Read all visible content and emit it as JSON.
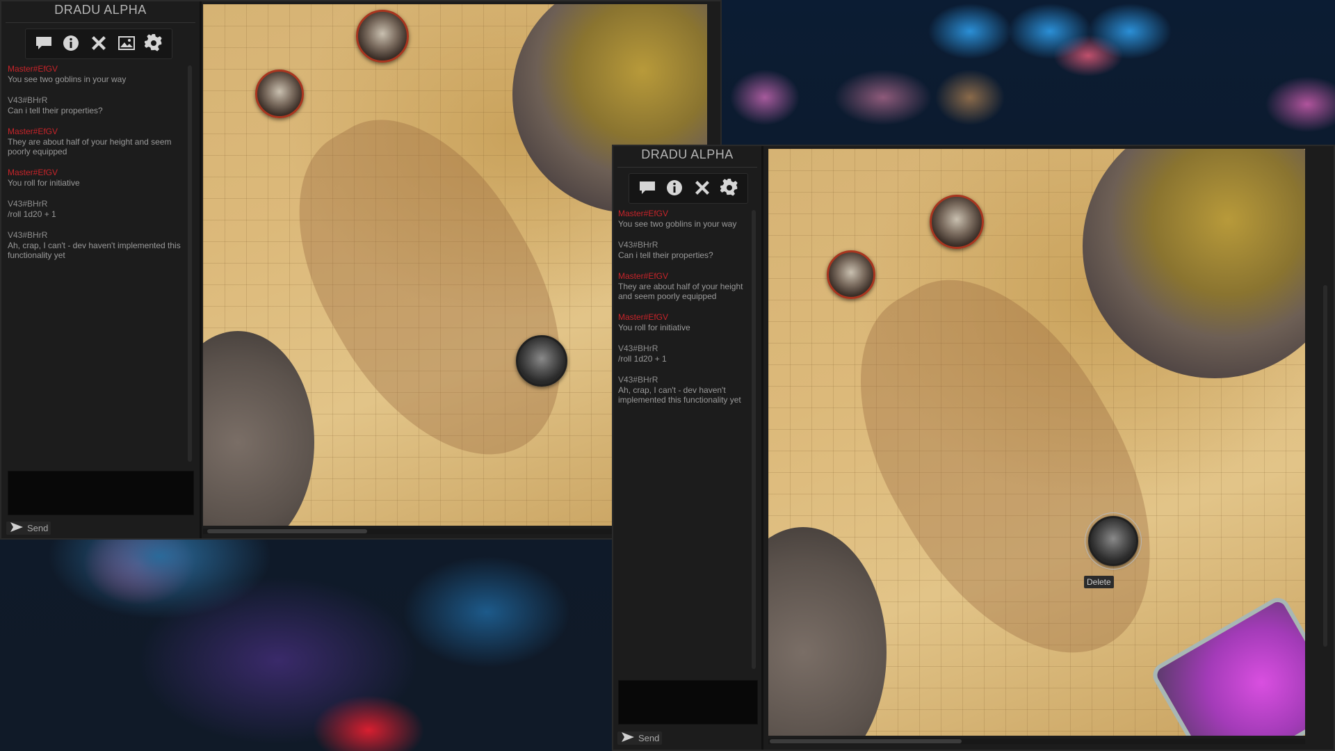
{
  "app": {
    "title": "DRADU ALPHA"
  },
  "toolbar": {
    "icons": [
      "chat-icon",
      "info-icon",
      "tools-icon",
      "image-icon",
      "gear-icon"
    ]
  },
  "chat": {
    "messages": [
      {
        "author": "Master#EfGV",
        "role": "master",
        "text": "You see two goblins in your way"
      },
      {
        "author": "V43#BHrR",
        "role": "player",
        "text": "Can i tell their properties?"
      },
      {
        "author": "Master#EfGV",
        "role": "master",
        "text": "They are about half of your height and seem poorly equipped"
      },
      {
        "author": "Master#EfGV",
        "role": "master",
        "text": "You roll for initiative"
      },
      {
        "author": "V43#BHrR",
        "role": "player",
        "text": "/roll 1d20 + 1"
      },
      {
        "author": "V43#BHrR",
        "role": "player",
        "text": "Ah, crap, I can't - dev haven't implemented this functionality yet"
      }
    ],
    "input_value": "",
    "send_label": "Send"
  },
  "map": {
    "tokens": [
      {
        "type": "goblin",
        "name": "goblin-1"
      },
      {
        "type": "goblin",
        "name": "goblin-2"
      },
      {
        "type": "hero",
        "name": "hero"
      }
    ],
    "context_menu": {
      "delete_label": "Delete"
    }
  },
  "colors": {
    "master_author": "#c8242a",
    "player_author": "#8f8f8f",
    "panel": "#1c1c1c"
  }
}
